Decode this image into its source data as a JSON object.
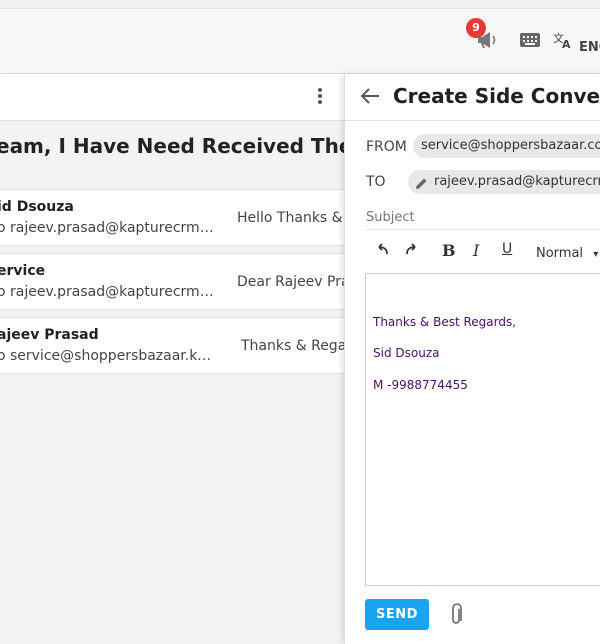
{
  "topbar": {
    "notification_count": "9",
    "language": "ENG",
    "icons": [
      "megaphone-icon",
      "keyboard-icon",
      "translate-icon"
    ]
  },
  "conversation": {
    "subject": "eam, I Have Need Received The Cou",
    "threads": [
      {
        "sender": "id Dsouza",
        "to": "o rajeev.prasad@kapturecrm.co...",
        "preview": "Hello Thanks & B"
      },
      {
        "sender": "ervice",
        "to": "o rajeev.prasad@kapturecrm.co...",
        "preview": "Dear Rajeev Pras"
      },
      {
        "sender": "ajeev Prasad",
        "to": "o service@shoppersbazaar.kapd...",
        "preview": "Thanks & Regar"
      }
    ]
  },
  "side_panel": {
    "title": "Create Side Conversa",
    "from_label": "FROM",
    "from_value": "service@shoppersbazaar.com",
    "to_label": "TO",
    "to_value": "rajeev.prasad@kapturecrm.",
    "subject_placeholder": "Subject",
    "format_select": "Normal",
    "signature": {
      "line1": "Thanks & Best Regards,",
      "line2": "Sid Dsouza",
      "line3": "M -9988774455"
    },
    "send_label": "SEND"
  },
  "colors": {
    "accent": "#1aa3f0",
    "badge": "#e53935",
    "signature_text": "#4a1060"
  }
}
